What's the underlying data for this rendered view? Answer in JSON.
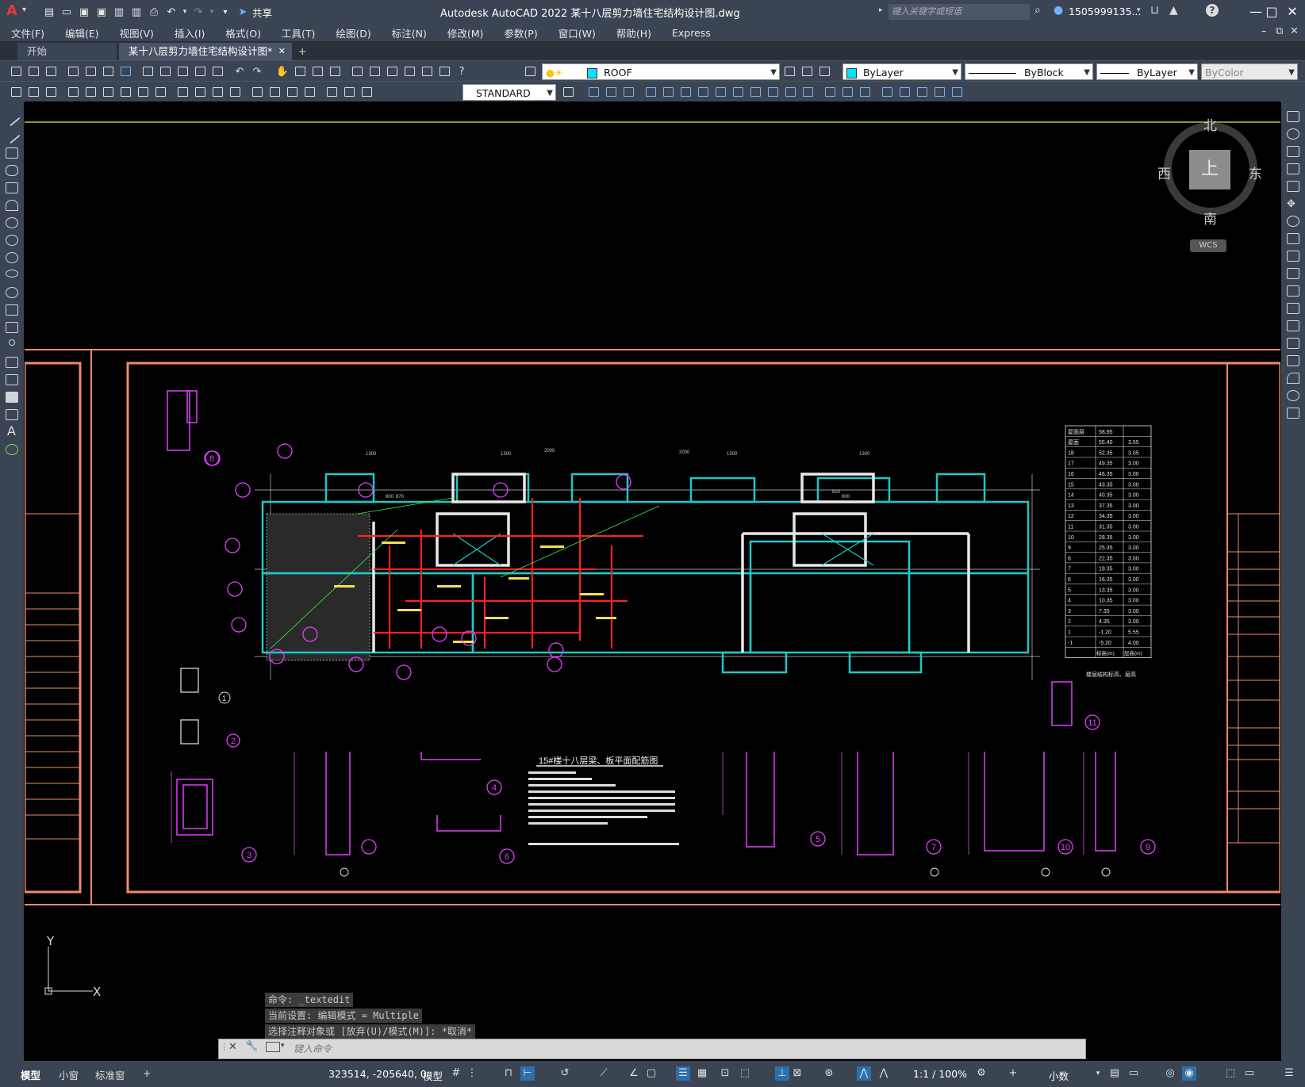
{
  "app": {
    "logo": "A",
    "title": "Autodesk AutoCAD 2022    某十八层剪力墙住宅结构设计图.dwg",
    "share_label": "共享",
    "search_placeholder": "键入关键字或短语",
    "user": "1505999135...",
    "help": "?"
  },
  "menu": [
    "文件(F)",
    "编辑(E)",
    "视图(V)",
    "插入(I)",
    "格式(O)",
    "工具(T)",
    "绘图(D)",
    "标注(N)",
    "修改(M)",
    "参数(P)",
    "窗口(W)",
    "帮助(H)",
    "Express"
  ],
  "tabs": {
    "start": "开始",
    "drawing": "某十八层剪力墙住宅结构设计图*",
    "close": "✕",
    "add": "+"
  },
  "toolbar": {
    "layer": "ROOF",
    "color": "ByLayer",
    "linetype": "ByBlock",
    "lineweight": "ByLayer",
    "plotstyle": "ByColor",
    "textstyle": "STANDARD"
  },
  "viewcube": {
    "top": "上",
    "north": "北",
    "south": "南",
    "east": "东",
    "west": "西",
    "wcs": "WCS"
  },
  "drawing": {
    "main_title": "15#楼十八层梁、板平面配筋图",
    "table_title": "楼层结构标高、层高",
    "table_header": [
      "标高(m)",
      "层高(m)"
    ],
    "floors": [
      [
        "屋面层",
        "58.95",
        ""
      ],
      [
        "屋面",
        "55.40",
        "3.55"
      ],
      [
        "18",
        "52.35",
        "3.05"
      ],
      [
        "17",
        "49.35",
        "3.00"
      ],
      [
        "16",
        "46.35",
        "3.00"
      ],
      [
        "15",
        "43.35",
        "3.00"
      ],
      [
        "14",
        "40.35",
        "3.00"
      ],
      [
        "13",
        "37.35",
        "3.00"
      ],
      [
        "12",
        "34.35",
        "3.00"
      ],
      [
        "11",
        "31.35",
        "3.00"
      ],
      [
        "10",
        "28.35",
        "3.00"
      ],
      [
        "9",
        "25.35",
        "3.00"
      ],
      [
        "8",
        "22.35",
        "3.00"
      ],
      [
        "7",
        "19.35",
        "3.00"
      ],
      [
        "6",
        "16.35",
        "3.00"
      ],
      [
        "5",
        "13.35",
        "3.00"
      ],
      [
        "4",
        "10.35",
        "3.00"
      ],
      [
        "3",
        "7.35",
        "3.00"
      ],
      [
        "2",
        "4.35",
        "3.00"
      ],
      [
        "1",
        "-1.20",
        "5.55"
      ],
      [
        "-1",
        "-5.20",
        "4.00"
      ]
    ],
    "dim_labels": [
      "1300",
      "1300",
      "2000",
      "2000",
      "1300",
      "1300",
      "900",
      "870",
      "820",
      "900"
    ],
    "detail_numbers": [
      "8",
      "1",
      "2",
      "3",
      "4",
      "5",
      "6",
      "7",
      "9",
      "10",
      "11"
    ]
  },
  "ucs": {
    "x": "X",
    "y": "Y"
  },
  "command": {
    "lines": [
      "命令: _textedit",
      "当前设置: 编辑模式 = Multiple",
      "选择注释对象或 [放弃(U)/模式(M)]: *取消*"
    ],
    "placeholder": "键入命令"
  },
  "status": {
    "tabs": [
      "模型",
      "小窗",
      "标准窗"
    ],
    "add": "+",
    "coords": "323514, -205640, 0",
    "model": "模型",
    "scale": "1:1 / 100%",
    "units": "小数"
  }
}
